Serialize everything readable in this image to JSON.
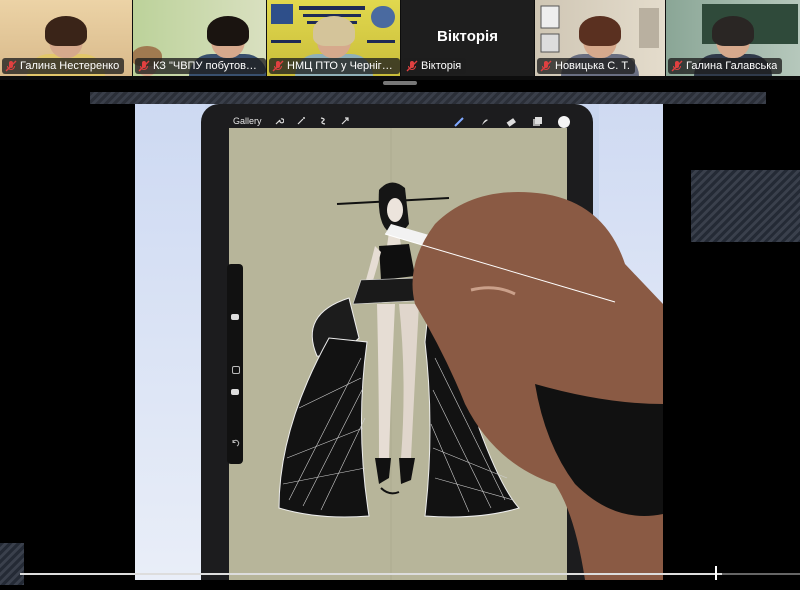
{
  "participants": [
    {
      "name": "Галина Нестеренко",
      "muted": true,
      "bg": "#e6c79d",
      "shirt": "#e2c76a",
      "hair": "#3a2418"
    },
    {
      "name": "КЗ \"ЧВПУ побутового об...",
      "muted": true,
      "active": true,
      "bg": "#c9d7a8",
      "shirt": "#39506e",
      "hair": "#1a1410"
    },
    {
      "name": "НМЦ ПТО у Чернігівс...",
      "muted": true,
      "bg": "#d9cd45",
      "shirt": "#8fb0b8",
      "hair": "#d4c49a"
    },
    {
      "name": "Вікторія",
      "muted": true,
      "camera_off": true,
      "center_label": "Вікторія"
    },
    {
      "name": "Новицька С. Т.",
      "muted": true,
      "bg": "#d7ccba",
      "shirt": "#6a6f82",
      "hair": "#5a3020"
    },
    {
      "name": "Галина Галавська",
      "muted": true,
      "bg": "#9bb2a4",
      "shirt": "#303a4a",
      "hair": "#2a2624"
    }
  ],
  "procreate": {
    "gallery_label": "Gallery"
  },
  "playback": {
    "progress_fraction": 0.9
  },
  "colors": {
    "active_speaker": "#2fd44a",
    "muted_icon": "#e04040",
    "canvas": "#b7b59a"
  }
}
